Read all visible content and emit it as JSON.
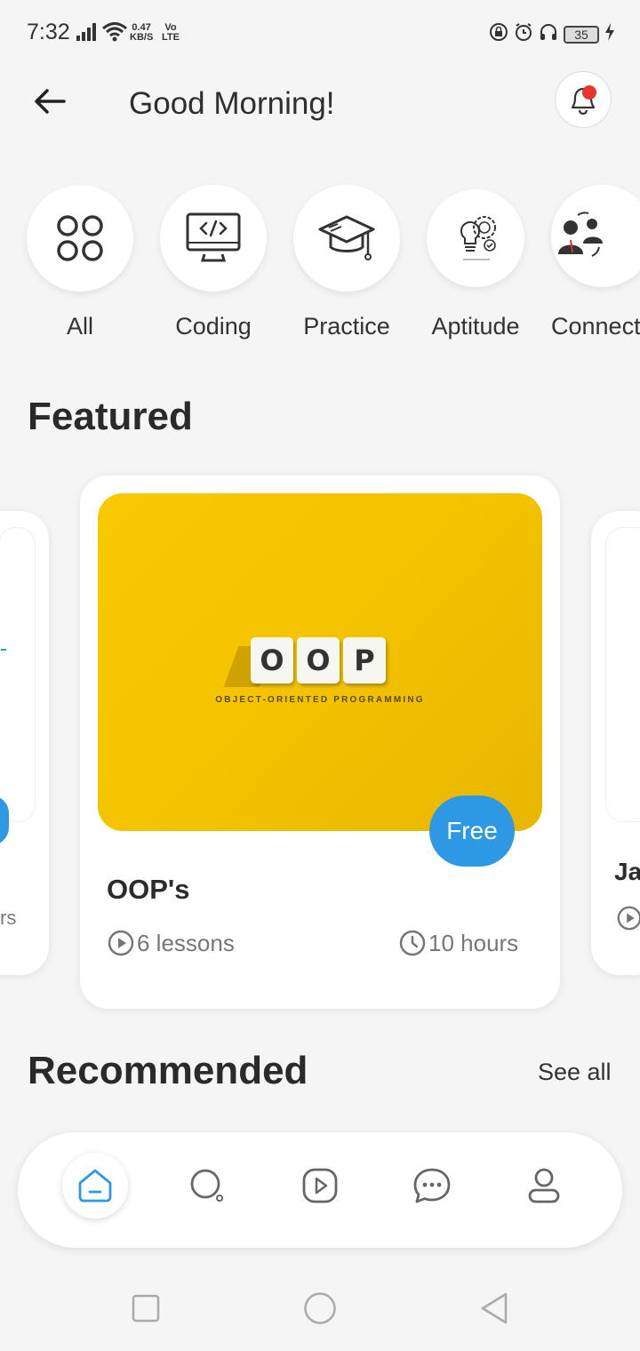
{
  "status_bar": {
    "time": "7:32",
    "speed_value": "0.47",
    "speed_unit": "KB/S",
    "network_top": "Vo",
    "network_bottom": "LTE",
    "battery": "35"
  },
  "header": {
    "greeting": "Good Morning!"
  },
  "categories": [
    {
      "label": "All",
      "icon": "grid-circles-icon"
    },
    {
      "label": "Coding",
      "icon": "monitor-code-icon"
    },
    {
      "label": "Practice",
      "icon": "graduation-cap-icon"
    },
    {
      "label": "Aptitude",
      "icon": "lightbulb-gear-icon"
    },
    {
      "label": "Connect",
      "icon": "people-connect-icon"
    }
  ],
  "featured": {
    "title": "Featured",
    "card": {
      "image_letters": [
        "O",
        "O",
        "P"
      ],
      "image_caption": "OBJECT-ORIENTED PROGRAMMING",
      "badge": "Free",
      "title": "OOP's",
      "lessons": "6 lessons",
      "duration": "10 hours"
    },
    "left_card_partial_text": "rs",
    "right_card_partial_title": "Ja"
  },
  "recommended": {
    "title": "Recommended",
    "see_all": "See all"
  },
  "colors": {
    "accent": "#2d98e3",
    "background": "#f5f5f5",
    "notification_dot": "#e8352b",
    "card_image": "#f4c400"
  },
  "bottom_nav": [
    "home-icon",
    "search-icon",
    "play-icon",
    "chat-icon",
    "profile-icon"
  ]
}
